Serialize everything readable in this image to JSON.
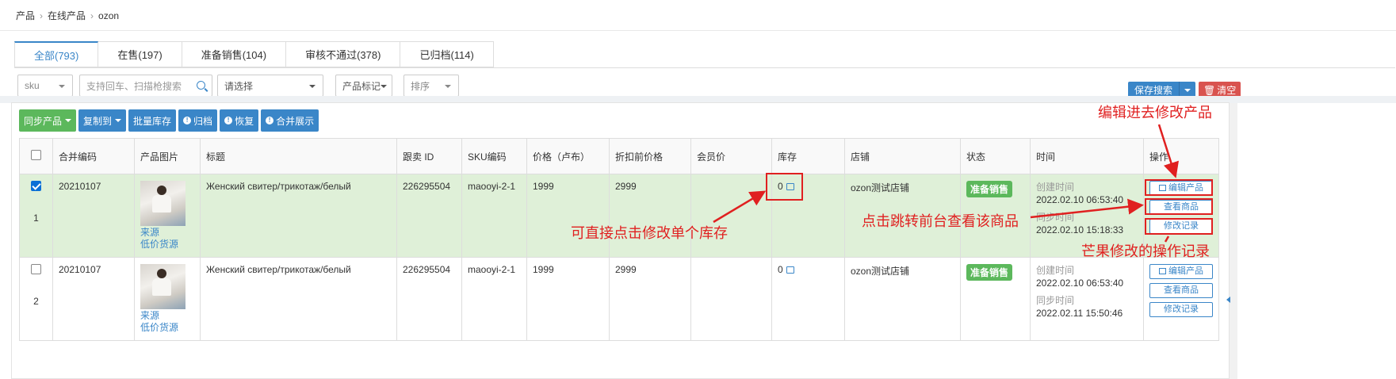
{
  "breadcrumb": [
    "产品",
    "在线产品",
    "ozon"
  ],
  "tabs": [
    {
      "label": "全部(793)",
      "active": true
    },
    {
      "label": "在售(197)",
      "active": false
    },
    {
      "label": "准备销售(104)",
      "active": false
    },
    {
      "label": "审核不通过(378)",
      "active": false
    },
    {
      "label": "已归档(114)",
      "active": false
    }
  ],
  "filters": {
    "sku": "sku",
    "search_placeholder": "支持回车、扫描枪搜索",
    "select": "请选择",
    "tag": "产品标记",
    "sort": "排序"
  },
  "actions": {
    "save_search": "保存搜索",
    "clear": "清空"
  },
  "toolbar": {
    "sync": "同步产品",
    "copy_to": "复制到",
    "bulk_stock": "批量库存",
    "archive": "归档",
    "restore": "恢复",
    "merge": "合并展示"
  },
  "columns": [
    "合并编码",
    "产品图片",
    "标题",
    "跟卖 ID",
    "SKU编码",
    "价格（卢布）",
    "折扣前价格",
    "会员价",
    "库存",
    "店铺",
    "状态",
    "时间",
    "操作"
  ],
  "rows": [
    {
      "index": "1",
      "checked": true,
      "merge_code": "20210107",
      "source_link": "来源",
      "cheap_link": "低价货源",
      "title": "Женский свитер/трикотаж/белый",
      "follow_id": "226295504",
      "sku": "maooyi-2-1",
      "price": "1999",
      "original_price": "2999",
      "member_price": "",
      "stock": "0",
      "shop": "ozon测试店铺",
      "status": "准备销售",
      "created_label": "创建时间",
      "created": "2022.02.10 06:53:40",
      "synced_label": "同步时间",
      "synced": "2022.02.10 15:18:33",
      "op_edit": "编辑产品",
      "op_view": "查看商品",
      "op_log": "修改记录"
    },
    {
      "index": "2",
      "checked": false,
      "merge_code": "20210107",
      "source_link": "来源",
      "cheap_link": "低价货源",
      "title": "Женский свитер/трикотаж/белый",
      "follow_id": "226295504",
      "sku": "maooyi-2-1",
      "price": "1999",
      "original_price": "2999",
      "member_price": "",
      "stock": "0",
      "shop": "ozon测试店铺",
      "status": "准备销售",
      "created_label": "创建时间",
      "created": "2022.02.10 06:53:40",
      "synced_label": "同步时间",
      "synced": "2022.02.11 15:50:46",
      "op_edit": "编辑产品",
      "op_view": "查看商品",
      "op_log": "修改记录"
    }
  ],
  "annotations": {
    "edit_note": "编辑进去修改产品",
    "stock_note": "可直接点击修改单个库存",
    "view_note": "点击跳转前台查看该商品",
    "log_note": "芒果修改的操作记录"
  },
  "colors": {
    "primary": "#3a86c8",
    "success": "#5cb85c",
    "danger": "#d9534f",
    "annotation": "#e02020",
    "selected_row": "#dff0d8"
  }
}
